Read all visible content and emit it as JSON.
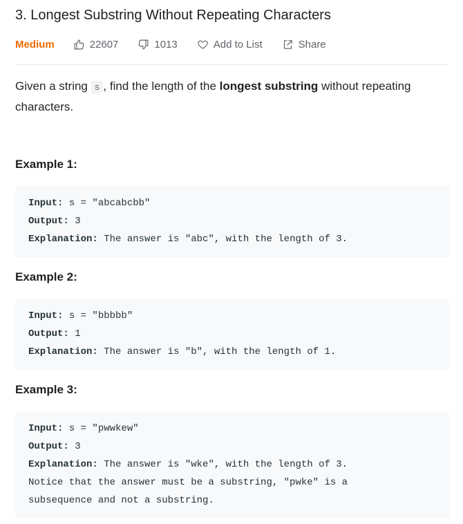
{
  "problem": {
    "title": "3. Longest Substring Without Repeating Characters",
    "difficulty": "Medium",
    "likes": "22607",
    "dislikes": "1013",
    "add_to_list_label": "Add to List",
    "share_label": "Share",
    "difficulty_color": "#ef6c00"
  },
  "description": {
    "part1": "Given a string ",
    "code": "s",
    "part2": ", find the length of the ",
    "bold": "longest substring",
    "part3": " without repeating characters."
  },
  "examples": [
    {
      "title": "Example 1:",
      "input_label": "Input:",
      "input_value": " s = \"abcabcbb\"",
      "output_label": "Output:",
      "output_value": " 3",
      "explanation_label": "Explanation:",
      "explanation_value": " The answer is \"abc\", with the length of 3.",
      "extra_lines": []
    },
    {
      "title": "Example 2:",
      "input_label": "Input:",
      "input_value": " s = \"bbbbb\"",
      "output_label": "Output:",
      "output_value": " 1",
      "explanation_label": "Explanation:",
      "explanation_value": " The answer is \"b\", with the length of 1.",
      "extra_lines": []
    },
    {
      "title": "Example 3:",
      "input_label": "Input:",
      "input_value": " s = \"pwwkew\"",
      "output_label": "Output:",
      "output_value": " 3",
      "explanation_label": "Explanation:",
      "explanation_value": " The answer is \"wke\", with the length of 3.",
      "extra_lines": [
        "Notice that the answer must be a substring, \"pwke\" is a",
        "subsequence and not a substring."
      ]
    }
  ]
}
